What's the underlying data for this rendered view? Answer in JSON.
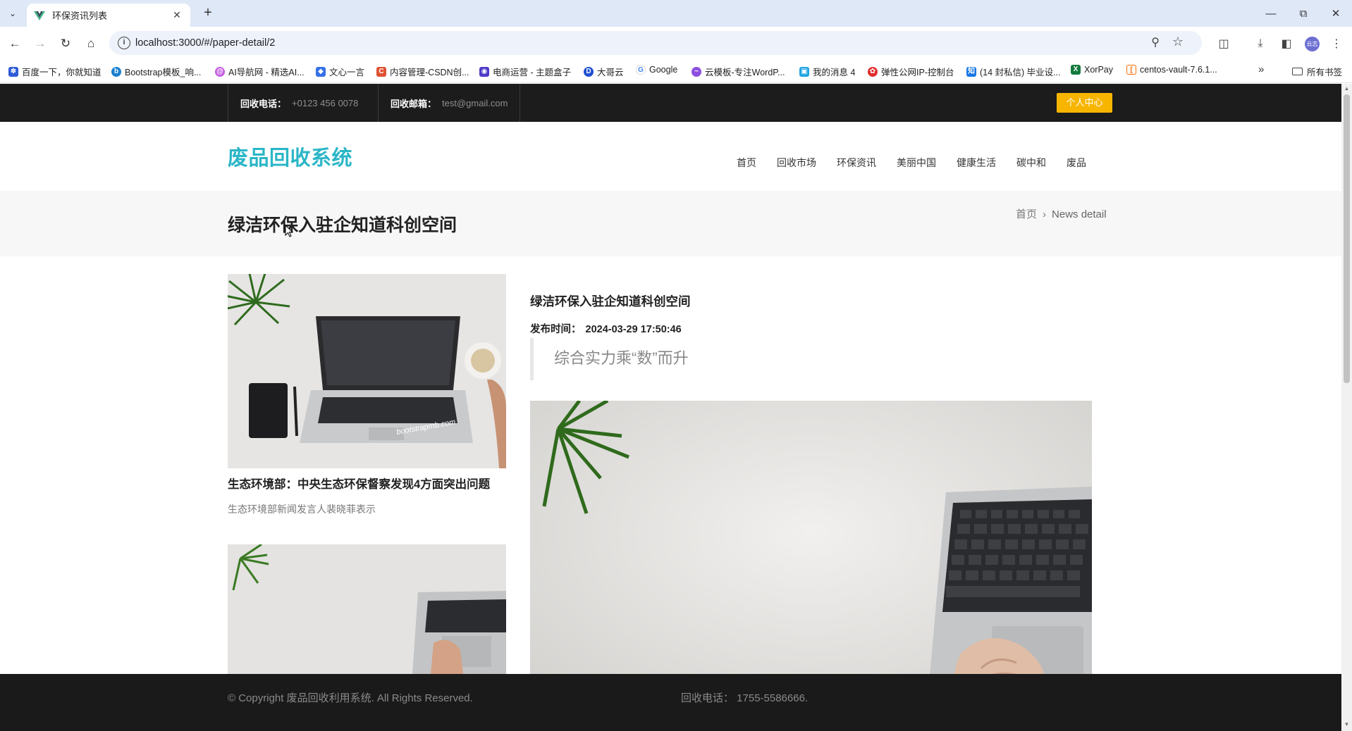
{
  "browser": {
    "tab_title": "环保资讯列表",
    "url": "localhost:3000/#/paper-detail/2",
    "bookmarks": [
      "百度一下，你就知道",
      "Bootstrap模板_响...",
      "AI导航网 - 精选AI...",
      "文心一言",
      "内容管理-CSDN创...",
      "电商运营 - 主题盒子",
      "大哥云",
      "Google",
      "云模板-专注WordP...",
      "我的消息 4",
      "弹性公网IP-控制台",
      "(14 封私信) 毕业设...",
      "XorPay",
      "centos-vault-7.6.1..."
    ],
    "bookmarks_folder": "所有书签",
    "avatar_text": "云志"
  },
  "topbar": {
    "phone_label": "回收电话：",
    "phone_value": "+0123 456 0078",
    "email_label": "回收邮箱：",
    "email_value": "test@gmail.com",
    "personal_center": "个人中心"
  },
  "header": {
    "logo": "废品回收系统",
    "nav": [
      "首页",
      "回收市场",
      "环保资讯",
      "美丽中国",
      "健康生活",
      "碳中和",
      "废品"
    ]
  },
  "titlebar": {
    "title": "绿洁环保入驻企知道科创空间",
    "breadcrumb_home": "首页",
    "breadcrumb_sep": "›",
    "breadcrumb_current": "News detail"
  },
  "sidebar": {
    "cards": [
      {
        "title": "生态环境部：中央生态环保督察发现4方面突出问题",
        "desc": "生态环境部新闻发言人裴晓菲表示",
        "image_text": "bootstrapmb.com"
      },
      {
        "title": "",
        "desc": "",
        "image_text": ""
      }
    ]
  },
  "article": {
    "title": "绿洁环保入驻企知道科创空间",
    "date_label": "发布时间：",
    "date_value": "2024-03-29 17:50:46",
    "quote": "综合实力乘“数”而升"
  },
  "footer": {
    "copyright": "© Copyright 废品回收利用系统. All Rights Reserved.",
    "tel": "回收电话：  1755-5586666."
  }
}
